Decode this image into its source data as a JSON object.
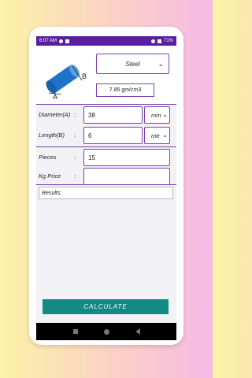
{
  "status": {
    "time": "6:07 AM",
    "battery": "71%"
  },
  "diagram": {
    "label_a": "A",
    "label_b": "B"
  },
  "material": {
    "selected": "Steel",
    "density": "7.85 gm/cm3"
  },
  "fields": {
    "diameter": {
      "label": "Diameter(A)",
      "value": "38",
      "unit": "mm"
    },
    "length": {
      "label": "Length(B)",
      "value": "6",
      "unit": "mtr"
    },
    "pieces": {
      "label": "Pieces",
      "value": "15"
    },
    "kg_price": {
      "label": "Kg Price",
      "value": ""
    }
  },
  "colon": ":",
  "results": {
    "label": "Results:"
  },
  "calculate_label": "CALCULATE",
  "colors": {
    "accent": "#7a3fb3",
    "statusbar": "#5a1ea0",
    "button": "#128a83"
  }
}
